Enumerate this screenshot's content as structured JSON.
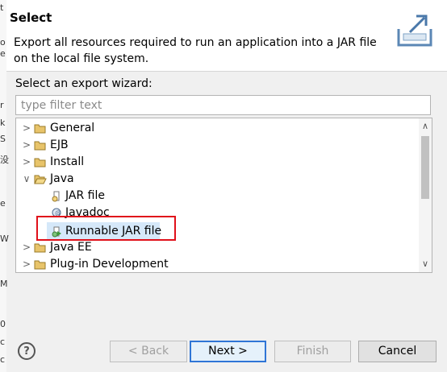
{
  "dialog": {
    "title": "Select",
    "description": "Export all resources required to run an application into a JAR file on the local file system."
  },
  "wizard": {
    "label": "Select an export wizard:",
    "filter_placeholder": "type filter text"
  },
  "tree": {
    "items": [
      {
        "label": "General",
        "icon": "folder-icon",
        "expanded": false
      },
      {
        "label": "EJB",
        "icon": "folder-icon",
        "expanded": false
      },
      {
        "label": "Install",
        "icon": "folder-icon",
        "expanded": false
      },
      {
        "label": "Java",
        "icon": "folder-icon",
        "expanded": true
      },
      {
        "label": "JAR file",
        "icon": "jar-file-icon"
      },
      {
        "label": "Javadoc",
        "icon": "javadoc-icon"
      },
      {
        "label": "Runnable JAR file",
        "icon": "runnable-jar-icon",
        "selected": true
      },
      {
        "label": "Java EE",
        "icon": "folder-icon",
        "expanded": false
      },
      {
        "label": "Plug-in Development",
        "icon": "folder-icon",
        "expanded": false
      }
    ]
  },
  "buttons": {
    "back": "< Back",
    "next": "Next >",
    "finish": "Finish",
    "cancel": "Cancel"
  },
  "colors": {
    "selection": "#d5e8f9",
    "highlight_box": "#e0101a",
    "default_button_border": "#2f75d6"
  }
}
